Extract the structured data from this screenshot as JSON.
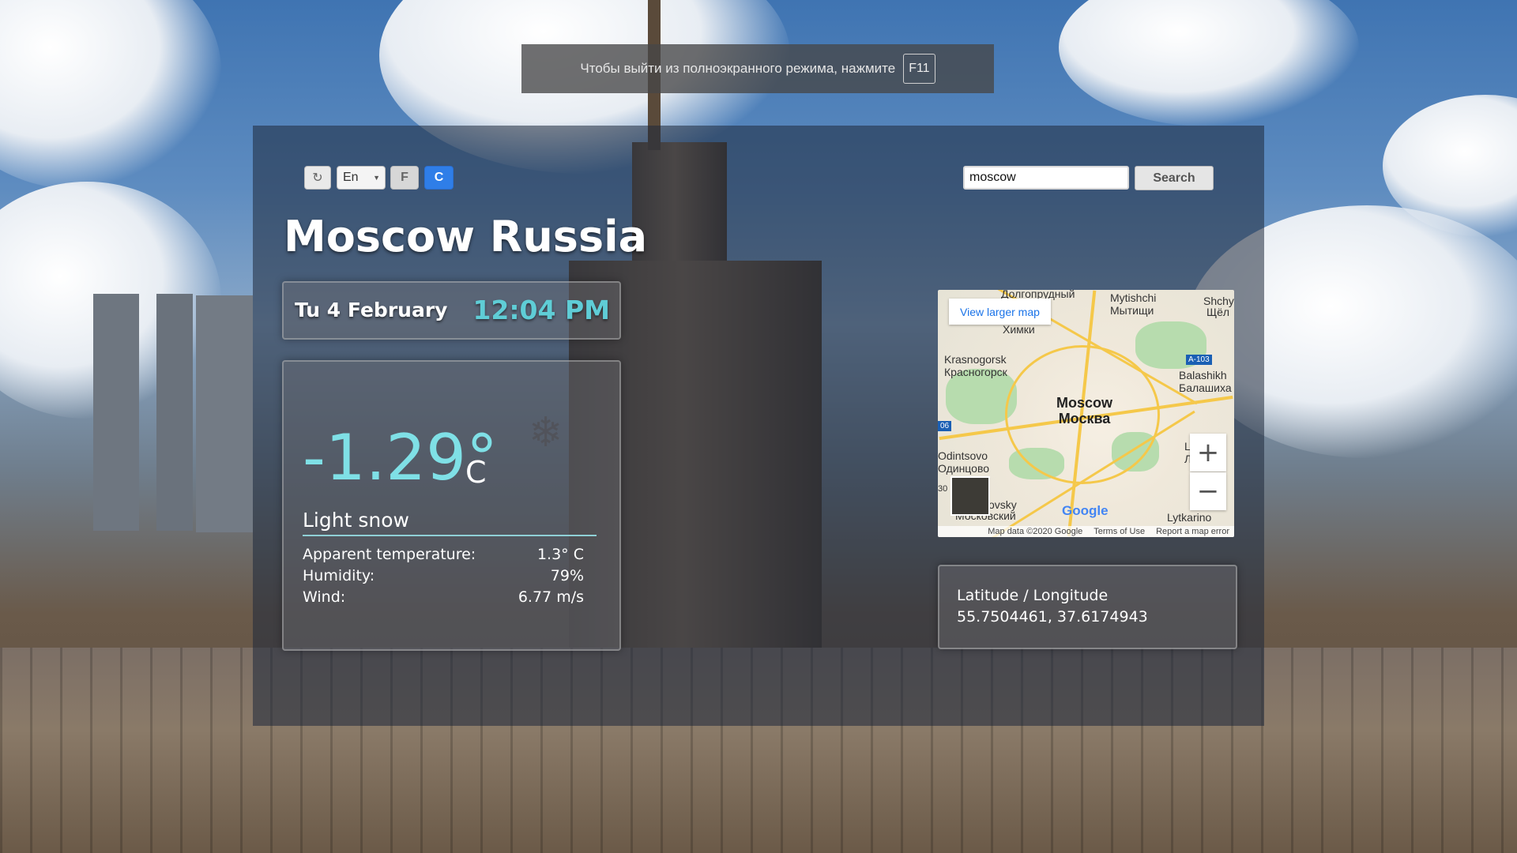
{
  "fullscreen_banner": {
    "text": "Чтобы выйти из полноэкранного режима, нажмите",
    "key": "F11"
  },
  "controls": {
    "refresh_icon": "refresh-icon",
    "refresh_glyph": "↻",
    "language": "En",
    "unit_f": "F",
    "unit_c": "C",
    "active_unit": "C",
    "active_color": "#2f7ee8"
  },
  "search": {
    "value": "moscow",
    "button": "Search"
  },
  "location": {
    "title": "Moscow Russia"
  },
  "datetime": {
    "date": "Tu 4 February",
    "time": "12:04 PM",
    "time_color": "#5fcdd6"
  },
  "weather": {
    "temperature": "-1.29°",
    "unit": "C",
    "icon": "snowflake-icon",
    "condition": "Light snow",
    "details": [
      {
        "label": "Apparent temperature:",
        "value": "1.3° C"
      },
      {
        "label": "Humidity:",
        "value": "79%"
      },
      {
        "label": "Wind:",
        "value": "6.77 m/s"
      }
    ]
  },
  "map": {
    "view_larger": "View larger map",
    "city_en": "Moscow",
    "city_ru": "Москва",
    "labels": [
      "Долгопрудный",
      "Mytishchi",
      "Мытищи",
      "Shchy",
      "Щёл",
      "Химки",
      "Krasnogorsk",
      "Красногорск",
      "Balashikh",
      "Балашиха",
      "A-103",
      "06",
      "Odintsovo",
      "Одинцово",
      "Lyub",
      "Люб",
      "ovsky",
      "Московский",
      "Lytkarino",
      "30"
    ],
    "zoom_in": "+",
    "zoom_out": "−",
    "google": "Google",
    "footer": [
      "Map data ©2020 Google",
      "Terms of Use",
      "Report a map error"
    ]
  },
  "coordinates": {
    "label": "Latitude / Longitude",
    "value": "55.7504461, 37.6174943"
  }
}
